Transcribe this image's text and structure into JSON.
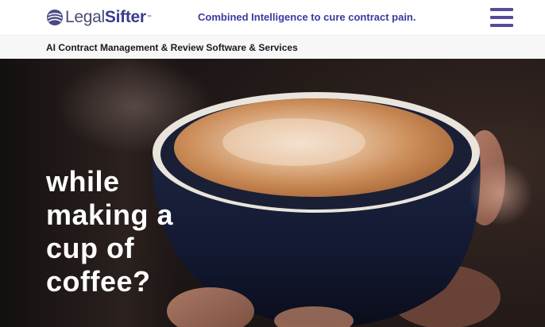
{
  "header": {
    "logo_text_light": "Legal",
    "logo_text_bold": "Sifter",
    "logo_tm": "™",
    "tagline": "Combined Intelligence to cure contract pain."
  },
  "subbar": {
    "text": "AI Contract Management & Review Software & Services"
  },
  "hero": {
    "headline_lines": [
      "while",
      "making a",
      "cup of",
      "coffee?"
    ]
  },
  "icons": {
    "logo": "legalsifter-globe-icon",
    "menu": "hamburger-menu-icon"
  },
  "colors": {
    "brand_purple": "#3b3b8f",
    "menu_purple": "#5a4a9a",
    "hero_text": "#ffffff"
  }
}
